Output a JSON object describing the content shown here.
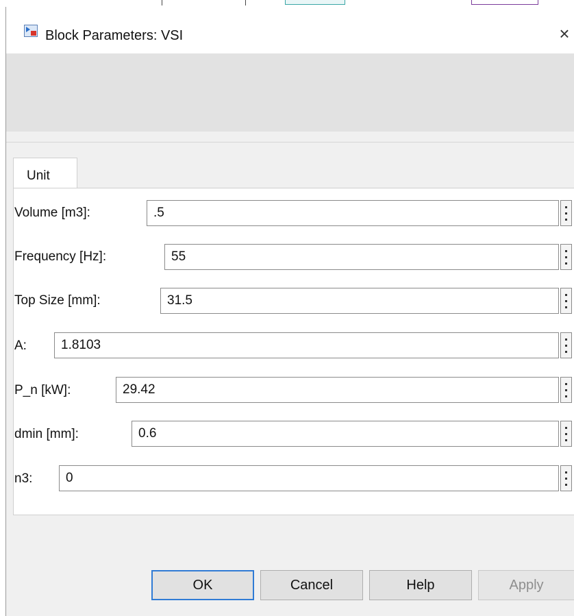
{
  "dialog": {
    "title": "Block Parameters: VSI",
    "close_glyph": "×",
    "icon": "simulink-block-icon"
  },
  "tabs": [
    {
      "label": "Unit",
      "active": true
    }
  ],
  "parameters": [
    {
      "label": "Volume [m3]:",
      "value": ".5"
    },
    {
      "label": "Frequency [Hz]:",
      "value": "55"
    },
    {
      "label": "Top Size [mm]:",
      "value": "31.5"
    },
    {
      "label": "A:",
      "value": "1.8103"
    },
    {
      "label": "P_n [kW]:",
      "value": "29.42"
    },
    {
      "label": "dmin [mm]:",
      "value": "0.6"
    },
    {
      "label": "n3:",
      "value": "0"
    }
  ],
  "buttons": {
    "ok": "OK",
    "cancel": "Cancel",
    "help": "Help",
    "apply": "Apply"
  },
  "colors": {
    "default_button_border": "#2f7bd5",
    "dialog_bg": "#f0f0f0",
    "description_bg": "#e2e2e2"
  }
}
